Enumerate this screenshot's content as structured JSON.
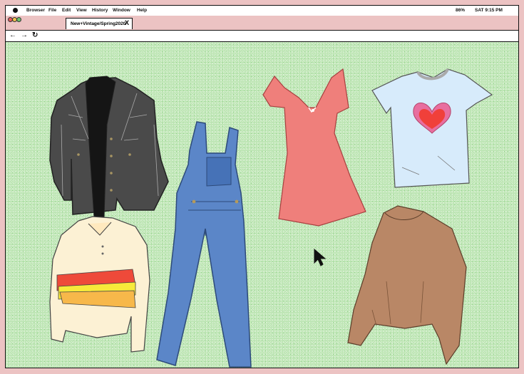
{
  "menubar": {
    "items": [
      "Browser",
      "File",
      "Edit",
      "View",
      "History",
      "Window",
      "Help"
    ],
    "battery": "86%",
    "clock": "SAT  9:15 PM"
  },
  "tab": {
    "title": "New+Vintage/Spring2020",
    "close_label": "X"
  },
  "nav": {
    "back": "←",
    "forward": "→",
    "reload": "↻"
  },
  "colors": {
    "background": "#bfe6b6",
    "frame": "#ecc3c3",
    "jacket": "#4a4a4a",
    "overalls": "#5b86c8",
    "dress": "#ef7f7b",
    "tshirt": "#d7ebfb",
    "sweater": "#b98766",
    "stripe_red": "#ee4a3a",
    "stripe_yellow": "#f7ea3a",
    "stripe_orange": "#f7b84a"
  },
  "items": [
    {
      "name": "denim-jacket",
      "icon": "jacket-icon"
    },
    {
      "name": "blue-overalls",
      "icon": "overalls-icon"
    },
    {
      "name": "pink-dress",
      "icon": "dress-icon"
    },
    {
      "name": "heart-tshirt",
      "icon": "tshirt-icon"
    },
    {
      "name": "striped-sweater",
      "icon": "sweater-icon"
    },
    {
      "name": "brown-sweater",
      "icon": "sweater-icon"
    }
  ]
}
